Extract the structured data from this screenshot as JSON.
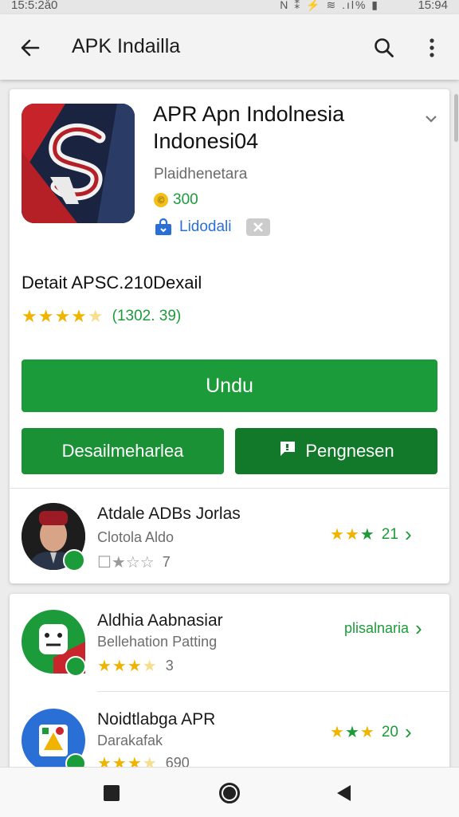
{
  "status_bar": {
    "time_left": "15:5:2å0",
    "icons": "N ⁑ ⚡ ≋ .ıl% ▮",
    "time_right": "15:94"
  },
  "app_bar": {
    "title": "APK Indailla"
  },
  "app": {
    "title_line1": "APR Apn Indolnesia",
    "title_line2": "Indonesi04",
    "developer": "Plaidhenetara",
    "price": "300",
    "install_tag": "Lidodali",
    "details_label": "Detait APSC.210Dexail",
    "rating_count": "(1302. 39)",
    "rating_stars": 4.5
  },
  "buttons": {
    "primary": "Undu",
    "secondary_left": "Desailmeharlea",
    "secondary_right": "Pengnesen"
  },
  "list": [
    {
      "title": "Atdale ADBs Jorlas",
      "subtitle": "Clotola Aldo",
      "meta": "7",
      "right_text": "21",
      "rating_stars": 1.5
    },
    {
      "title": "Aldhia Aabnasiar",
      "subtitle": "Bellehation Patting",
      "meta": "3",
      "right_text": "plisalnaria",
      "rating_stars": 3.5
    },
    {
      "title": "Noidtlabga APR",
      "subtitle": "Darakafak",
      "meta": "690",
      "right_text": "20",
      "rating_stars": 3.5
    }
  ],
  "colors": {
    "primary_green": "#1c9b3a",
    "dark_green": "#12792a",
    "star_yellow": "#f0b400",
    "link_blue": "#2a6fd6"
  }
}
